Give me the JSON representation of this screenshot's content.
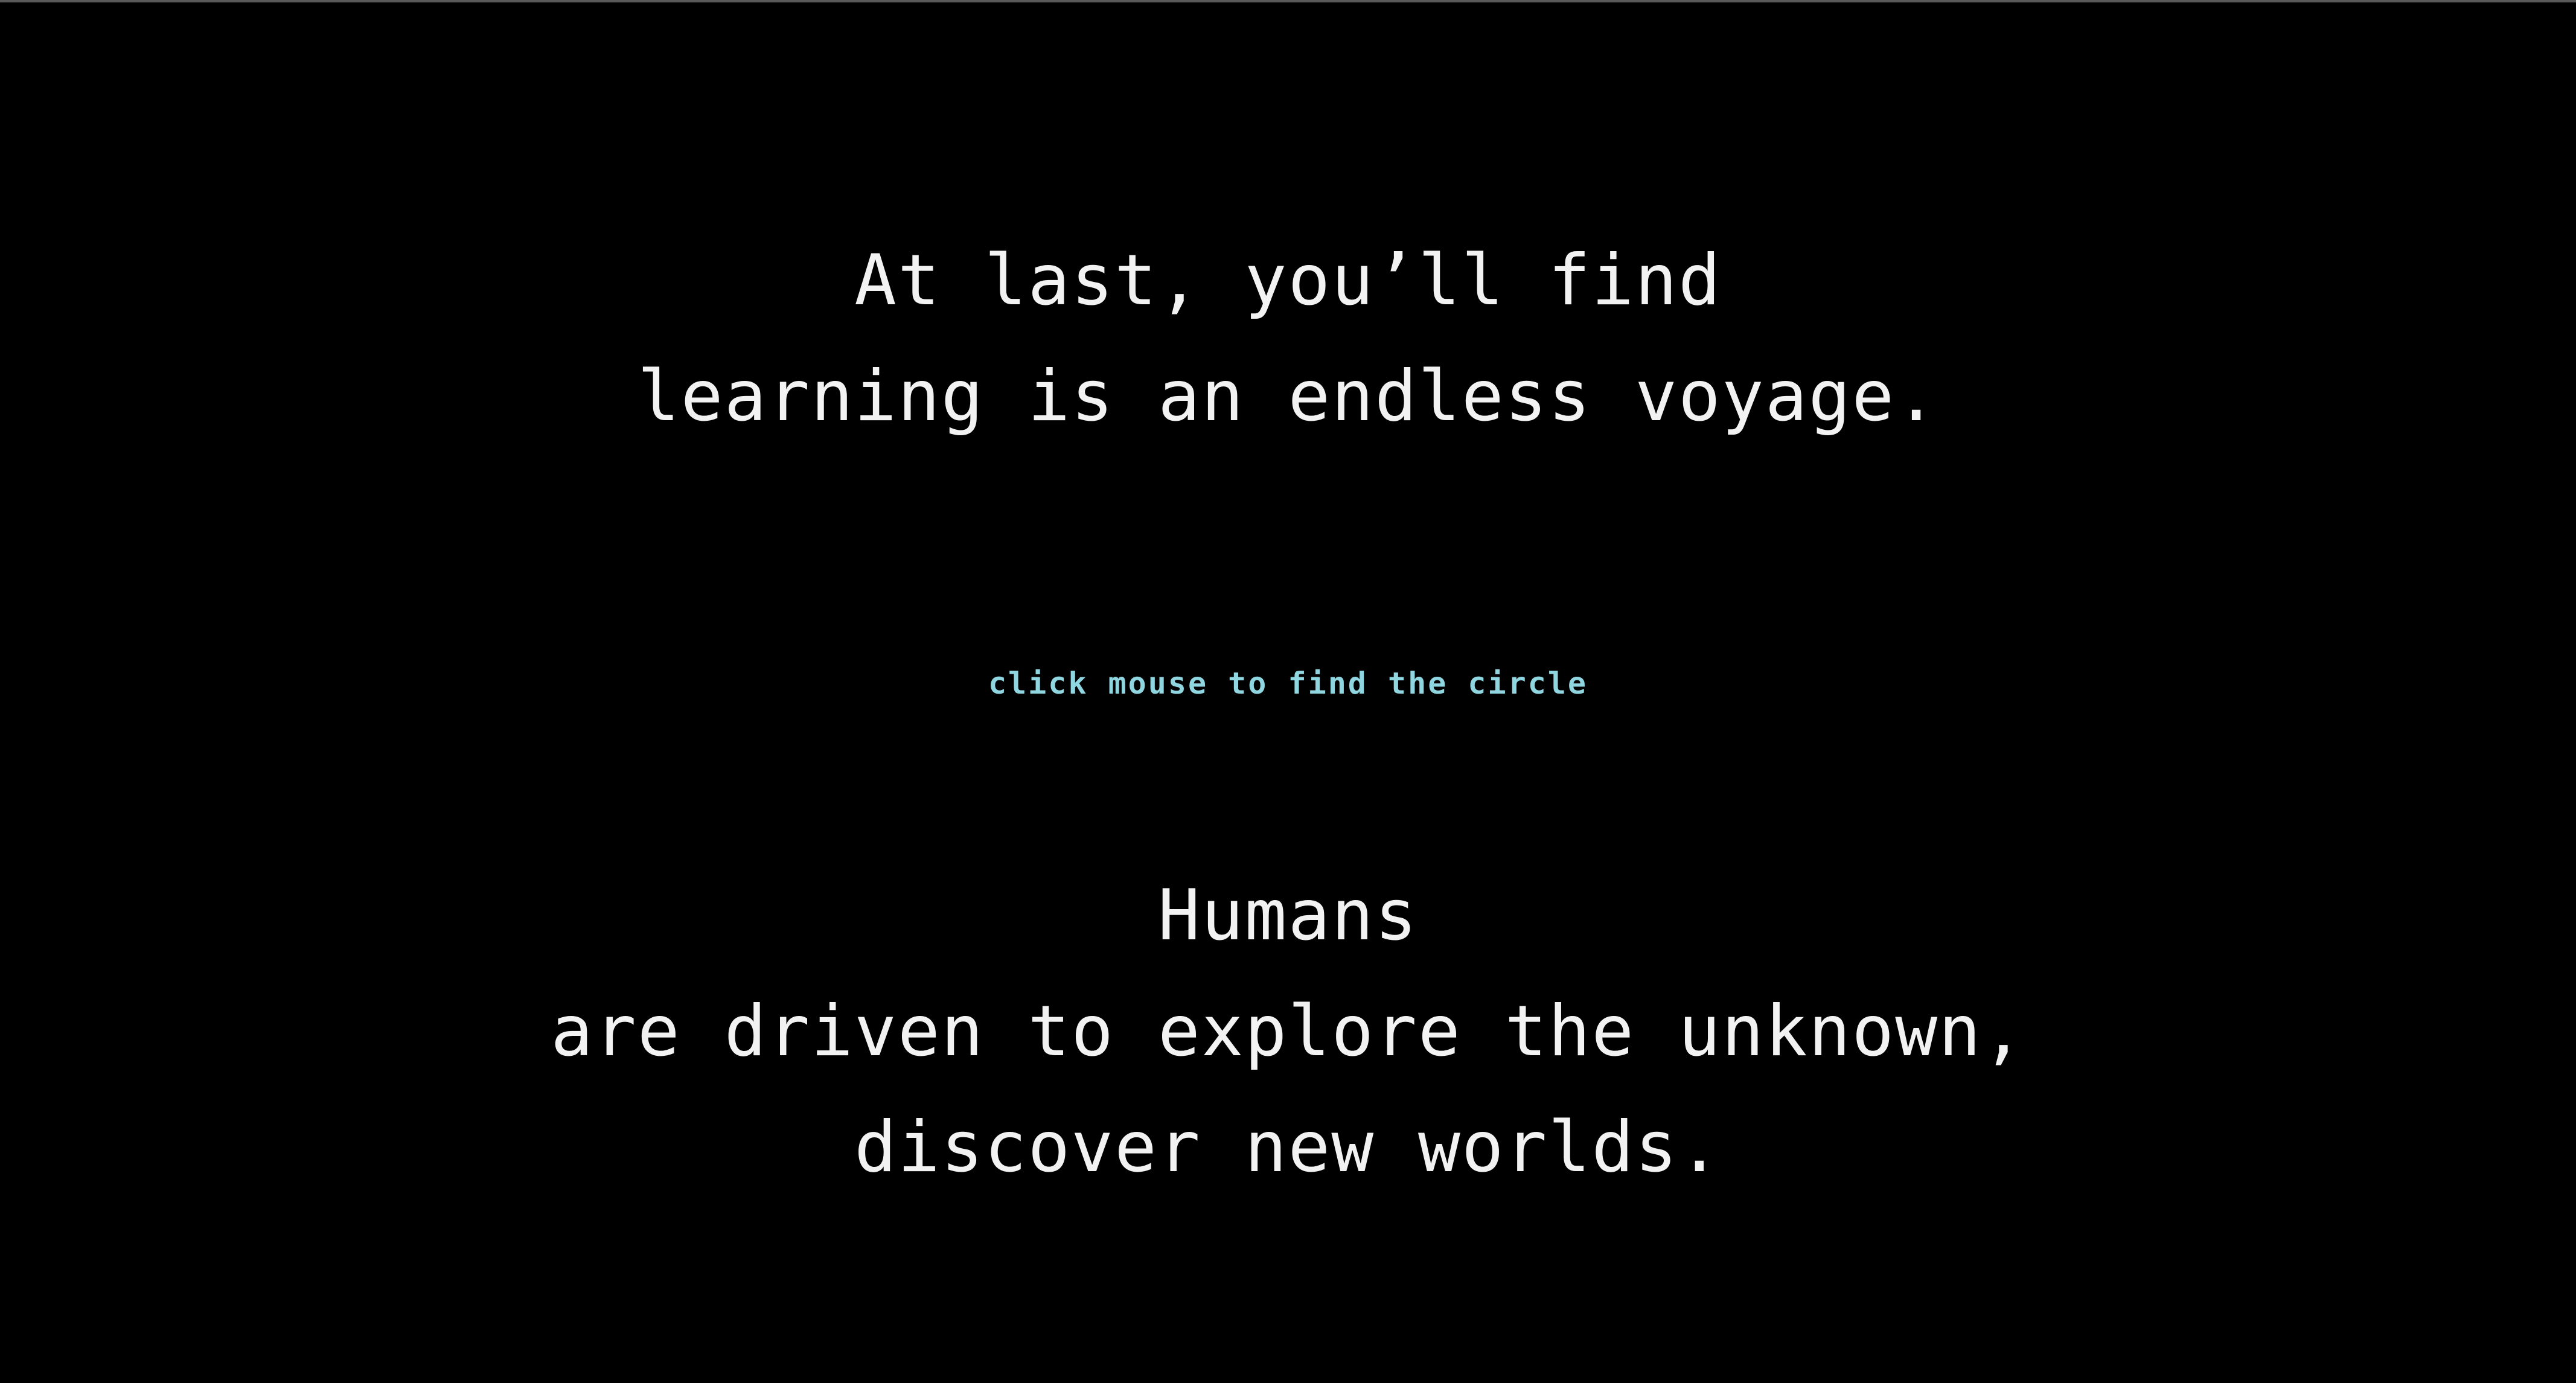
{
  "intro": {
    "line1": "At last, you’ll find",
    "line2": "learning is an endless voyage."
  },
  "hint": {
    "text": "click mouse to find the circle",
    "color": "#8fd6e0"
  },
  "outro": {
    "line1": "Humans",
    "line2": "are driven to explore the unknown,",
    "line3": "discover new worlds."
  },
  "colors": {
    "background": "#000000",
    "text": "#f2f2f2"
  }
}
